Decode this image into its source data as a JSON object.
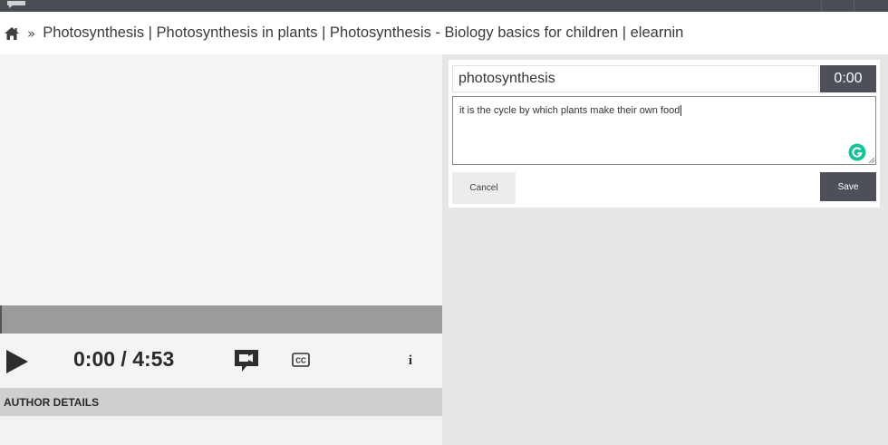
{
  "breadcrumb": {
    "separator": "»",
    "title": "Photosynthesis | Photosynthesis in plants | Photosynthesis - Biology basics for children | elearnin"
  },
  "player": {
    "time_display": "0:00 / 4:53",
    "progress": 0,
    "cc_label": "CC",
    "info_label": "i"
  },
  "author": {
    "heading": "AUTHOR DETAILS"
  },
  "note": {
    "title_value": "photosynthesis",
    "timestamp": "0:00",
    "body_value": "it is the cycle by which plants make their own food",
    "cancel_label": "Cancel",
    "save_label": "Save"
  },
  "colors": {
    "topbar": "#4a4d54",
    "dark_button": "#4d5058",
    "progress_bar": "#9b9b9b",
    "author_bar": "#cfcfcf",
    "grammarly": "#15c39a"
  },
  "icons": {
    "home": "home-icon",
    "play": "play-icon",
    "camera": "video-camera-icon",
    "cc": "closed-captions-icon",
    "info": "info-icon",
    "grammarly": "grammarly-icon"
  }
}
